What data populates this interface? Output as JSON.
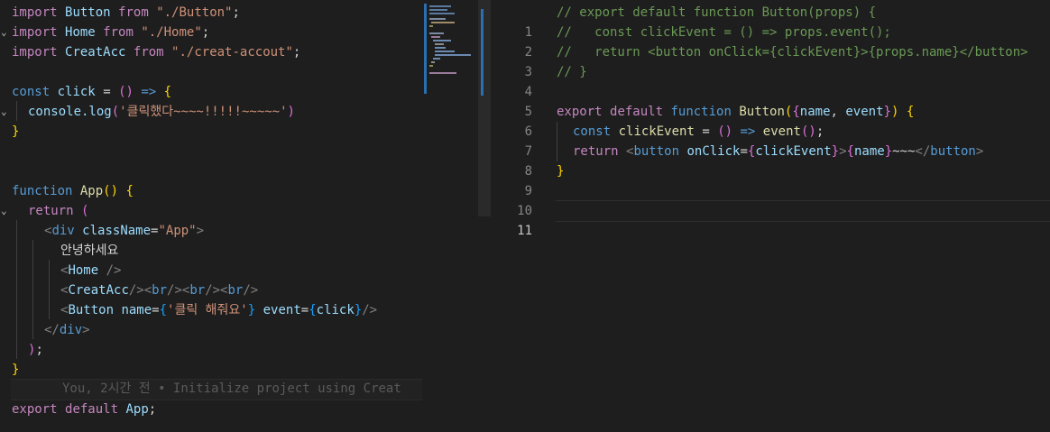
{
  "left_editor": {
    "blame_text": "You, 2시간 전 • Initialize project using Creat"
  },
  "right_editor": {
    "line_numbers": [
      "1",
      "2",
      "3",
      "4",
      "5",
      "6",
      "7",
      "8",
      "9",
      "10",
      "11"
    ],
    "active_line": "11"
  },
  "tokens": {
    "import": "import",
    "from": "from",
    "Button": "Button",
    "Home": "Home",
    "CreatAcc": "CreatAcc",
    "path_button": "\"./Button\"",
    "path_home": "\"./Home\"",
    "path_creat": "\"./creat-accout\"",
    "const": "const",
    "click": "click",
    "console_log": "console.log",
    "log_msg": "'클릭했다~~~~!!!!!~~~~~'",
    "function": "function",
    "App": "App",
    "return": "return",
    "div": "div",
    "className": "className",
    "app_str": "\"App\"",
    "hello": "안녕하세요",
    "br": "br",
    "name": "name",
    "name_val": "'클릭 해줘요'",
    "event": "event",
    "export": "export",
    "default": "default",
    "c1": "// export default function Button(props) {",
    "c2": "//   const clickEvent = () => props.event();",
    "c3": "//   return <button onClick={clickEvent}>{props.name}</button>",
    "c4": "// }",
    "clickEvent": "clickEvent",
    "button": "button",
    "onClick": "onClick",
    "tilde": "~~~"
  }
}
